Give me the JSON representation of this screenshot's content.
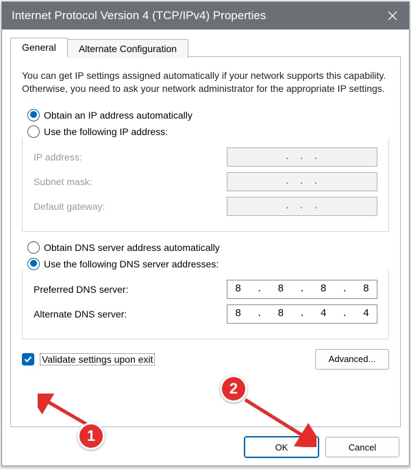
{
  "window": {
    "title": "Internet Protocol Version 4 (TCP/IPv4) Properties"
  },
  "tabs": {
    "general": "General",
    "alternate": "Alternate Configuration"
  },
  "desc": "You can get IP settings assigned automatically if your network supports this capability. Otherwise, you need to ask your network administrator for the appropriate IP settings.",
  "ip": {
    "auto": "Obtain an IP address automatically",
    "manual": "Use the following IP address:",
    "addr_label": "IP address:",
    "mask_label": "Subnet mask:",
    "gw_label": "Default gateway:",
    "dots": ".     .     ."
  },
  "dns": {
    "auto": "Obtain DNS server address automatically",
    "manual": "Use the following DNS server addresses:",
    "pref_label": "Preferred DNS server:",
    "alt_label": "Alternate DNS server:",
    "pref": [
      "8",
      "8",
      "8",
      "8"
    ],
    "alt": [
      "8",
      "8",
      "4",
      "4"
    ]
  },
  "validate": "Validate settings upon exit",
  "buttons": {
    "advanced": "Advanced...",
    "ok": "OK",
    "cancel": "Cancel"
  },
  "anno": {
    "one": "1",
    "two": "2"
  }
}
